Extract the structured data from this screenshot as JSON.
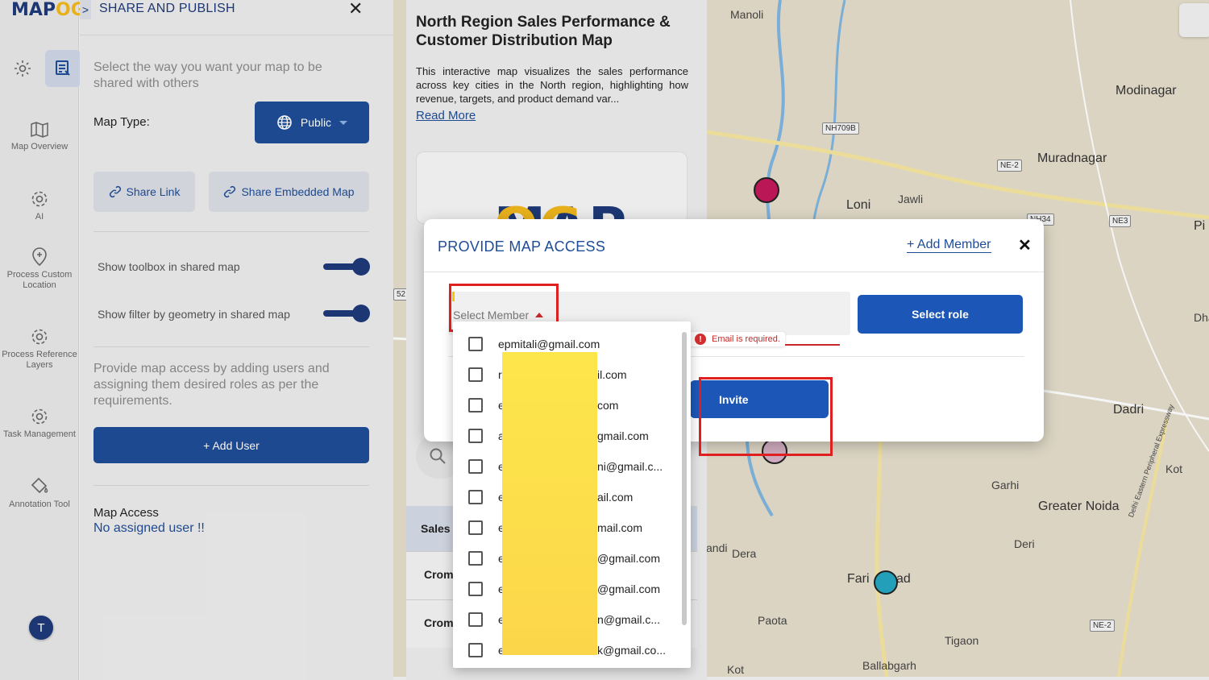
{
  "logo": {
    "main": "MAP",
    "accent": "OG"
  },
  "rail": {
    "items": [
      {
        "label": "Map Overview"
      },
      {
        "label": "AI"
      },
      {
        "label": "Process Custom Location"
      },
      {
        "label": "Process Reference Layers"
      },
      {
        "label": "Task Management"
      },
      {
        "label": "Annotation Tool"
      }
    ],
    "avatar": "T"
  },
  "panel": {
    "chevron": ">",
    "title": "SHARE AND PUBLISH",
    "close": "✕",
    "description": "Select the way you want your map to be shared with others",
    "map_type_label": "Map Type:",
    "map_type_value": "Public",
    "share_link": "Share Link",
    "share_embedded": "Share Embedded Map",
    "toggle_toolbox": "Show toolbox in shared map",
    "toggle_filter": "Show filter by geometry in shared map",
    "access_description": "Provide map access by adding users and assigning them desired roles as per the requirements.",
    "add_user": "+ Add User",
    "map_access_label": "Map Access",
    "map_access_value": "No assigned user !!"
  },
  "card": {
    "title": "North Region Sales Performance & Customer Distribution Map",
    "body": "This interactive map visualizes the sales performance across key cities in the North region, highlighting how revenue, targets, and product demand var...",
    "read_more": "Read More",
    "logo_main": "MAP",
    "logo_accent": "OG",
    "table_header": "Sales",
    "rows": [
      "Crom",
      "Crom"
    ]
  },
  "map": {
    "labels": {
      "manoli": "Manoli",
      "modinagar": "Modinagar",
      "muradnagar": "Muradnagar",
      "loni": "Loni",
      "jawli": "Jawli",
      "dadri": "Dadri",
      "garhi": "Garhi",
      "greater_noida": "Greater Noida",
      "deri": "Deri",
      "kot": "Kot",
      "faridabad_a": "Fari",
      "faridabad_b": "ad",
      "dera": "Dera",
      "andi": "andi",
      "paota": "Paota",
      "tigaon": "Tigaon",
      "ballabgarh": "Ballabgarh",
      "kot2": "Kot",
      "pi": "Pi",
      "dha": "Dha",
      "expressway": "Delhi Eastern Peripheral Expressway"
    },
    "shields": {
      "nh709b": "NH709B",
      "ne2a": "NE-2",
      "nh34": "NH34",
      "ne3": "NE3",
      "ne2b": "NE-2",
      "s52": "52"
    },
    "colors": {
      "pin_magenta": "#c2185b",
      "pin_teal": "#26a6c2"
    }
  },
  "modal": {
    "title": "PROVIDE MAP ACCESS",
    "add_member": "+ Add Member",
    "close": "✕",
    "select_member": "Select Member",
    "select_role": "Select role",
    "error": "Email is required.",
    "invite": "Invite"
  },
  "dropdown": {
    "items": [
      {
        "lead": "epmitali@gmail.com",
        "suffix": ""
      },
      {
        "lead": "r",
        "suffix": "il.com"
      },
      {
        "lead": "e",
        "suffix": "com"
      },
      {
        "lead": "a",
        "suffix": "gmail.com"
      },
      {
        "lead": "e",
        "suffix": "ni@gmail.c..."
      },
      {
        "lead": "e",
        "suffix": "ail.com"
      },
      {
        "lead": "e",
        "suffix": "mail.com"
      },
      {
        "lead": "e",
        "suffix": "@gmail.com"
      },
      {
        "lead": "e",
        "suffix": "@gmail.com"
      },
      {
        "lead": "e",
        "suffix": "n@gmail.c..."
      },
      {
        "lead": "e",
        "suffix": "k@gmail.co..."
      }
    ]
  },
  "colors": {
    "brand": "#1e3a78",
    "primary_button": "#1c57b8",
    "accent": "#f2b91e",
    "error": "#c62828",
    "highlight": "#e02020"
  }
}
